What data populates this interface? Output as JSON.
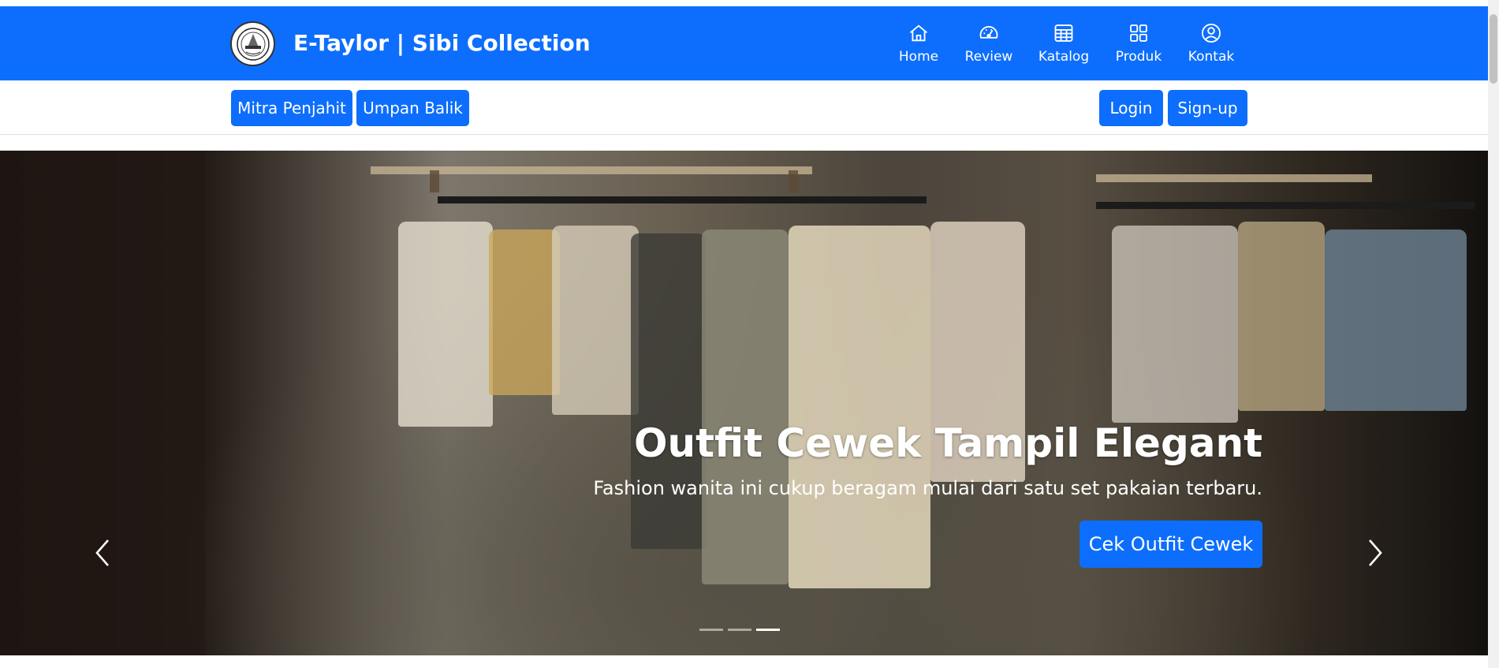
{
  "brand": {
    "title": "E-Taylor | Sibi Collection",
    "logo_icon": "crest-logo-icon"
  },
  "nav": {
    "items": [
      {
        "label": "Home",
        "icon": "house-icon"
      },
      {
        "label": "Review",
        "icon": "speedometer-icon"
      },
      {
        "label": "Katalog",
        "icon": "table-icon"
      },
      {
        "label": "Produk",
        "icon": "grid-icon"
      },
      {
        "label": "Kontak",
        "icon": "person-circle-icon"
      }
    ]
  },
  "subbar": {
    "left_buttons": [
      "Mitra Penjahit",
      "Umpan Balik"
    ],
    "login": "Login",
    "signup": "Sign-up"
  },
  "carousel": {
    "title": "Outfit Cewek Tampil Elegant",
    "text": "Fashion wanita ini cukup beragam mulai dari satu set pakaian terbaru.",
    "button": "Cek Outfit Cewek",
    "prev_icon": "chevron-left-icon",
    "next_icon": "chevron-right-icon",
    "slide_count": 3,
    "active_slide": 3
  },
  "colors": {
    "primary": "#0d6efd",
    "white": "#ffffff"
  }
}
